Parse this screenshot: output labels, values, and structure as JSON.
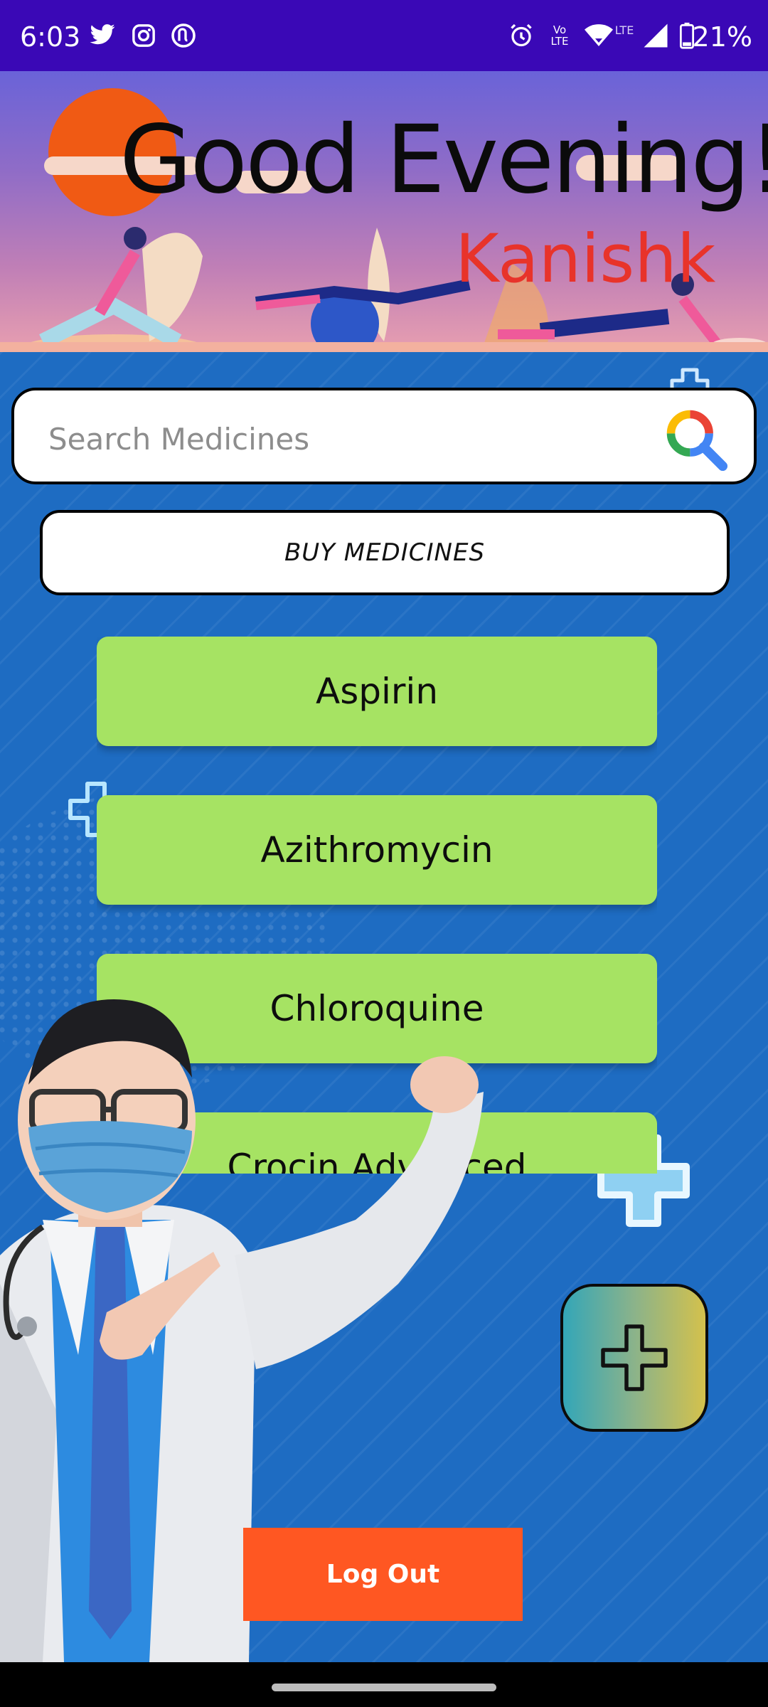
{
  "status_bar": {
    "time": "6:03",
    "battery": "21%",
    "left_icons": [
      "twitter-icon",
      "instagram-icon",
      "app-notification-icon"
    ],
    "right_icons": [
      "alarm-icon",
      "volte-icon",
      "wifi-icon",
      "signal-icon",
      "battery-icon"
    ],
    "volte_label": "Vo LTE",
    "lte_label": "LTE"
  },
  "header": {
    "greeting": "Good Evening!!",
    "username": "Kanishk"
  },
  "search": {
    "placeholder": "Search Medicines"
  },
  "buy_button": {
    "label": "BUY MEDICINES"
  },
  "medicines": [
    "Aspirin",
    "Azithromycin",
    "Chloroquine",
    "Crocin Advanced"
  ],
  "logout": {
    "label": "Log Out"
  },
  "colors": {
    "status_bar": "#3a08b6",
    "background": "#1e6cc2",
    "medicine_item": "#a6e363",
    "logout": "#ff5722",
    "username": "#e8332a"
  }
}
